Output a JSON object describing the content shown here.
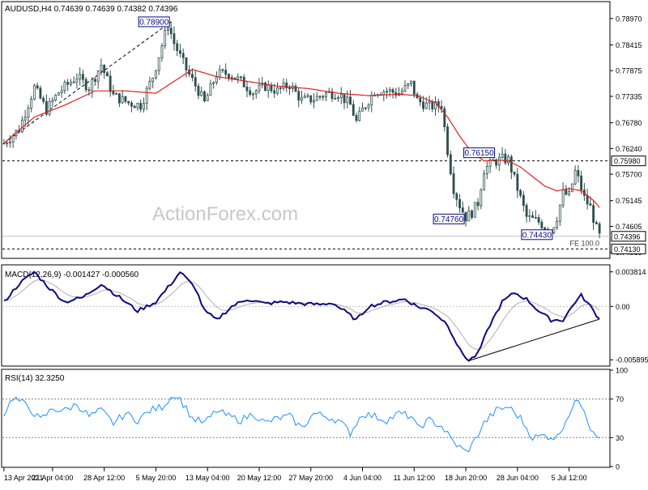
{
  "header": {
    "symbol_line": "AUDUSD,H4  0.74639 0.74639 0.74382 0.74396"
  },
  "watermark": "ActionForex.com",
  "colors": {
    "candles": "#2f4f4f",
    "ma": "#e02020",
    "macd_main": "#0b0b80",
    "macd_signal": "#b0b0b0",
    "rsi": "#1e90ff",
    "frame": "#000000",
    "grid_dash": "#808080",
    "label_box": "#0b0b80"
  },
  "chart_data": [
    {
      "type": "candlestick",
      "name": "price",
      "title": "AUDUSD,H4  0.74639 0.74639 0.74382 0.74396",
      "ylim": [
        0.7395,
        0.7929
      ],
      "y_ticks": [
        "0.78970",
        "0.78415",
        "0.77875",
        "0.77335",
        "0.76780",
        "0.76240",
        "0.75700",
        "0.75145",
        "0.74605",
        "0.74060"
      ],
      "y_tick_values": [
        0.7897,
        0.78415,
        0.77875,
        0.77335,
        0.7678,
        0.7624,
        0.757,
        0.75145,
        0.74605,
        0.7406
      ],
      "x_ticks": [
        "13 Apr 2021",
        "21 Apr 04:00",
        "28 Apr 12:00",
        "5 May 20:00",
        "13 May 04:00",
        "20 May 12:00",
        "27 May 20:00",
        "4 Jun 04:00",
        "11 Jun 12:00",
        "18 Jun 20:00",
        "28 Jun 04:00",
        "5 Jul 12:00"
      ],
      "x_tick_index": [
        0,
        16,
        33,
        50,
        67,
        84,
        101,
        118,
        135,
        152,
        169,
        186
      ],
      "bar_count": 197,
      "close_anchors": [
        [
          0,
          0.7635
        ],
        [
          5,
          0.7665
        ],
        [
          10,
          0.7752
        ],
        [
          14,
          0.7705
        ],
        [
          18,
          0.7742
        ],
        [
          24,
          0.7775
        ],
        [
          28,
          0.7752
        ],
        [
          32,
          0.78
        ],
        [
          36,
          0.7735
        ],
        [
          41,
          0.772
        ],
        [
          45,
          0.7715
        ],
        [
          49,
          0.7775
        ],
        [
          54,
          0.7885
        ],
        [
          56,
          0.7845
        ],
        [
          60,
          0.779
        ],
        [
          64,
          0.7745
        ],
        [
          66,
          0.772
        ],
        [
          70,
          0.778
        ],
        [
          74,
          0.7782
        ],
        [
          78,
          0.7765
        ],
        [
          82,
          0.7742
        ],
        [
          86,
          0.7755
        ],
        [
          90,
          0.7745
        ],
        [
          94,
          0.7758
        ],
        [
          98,
          0.7725
        ],
        [
          102,
          0.7728
        ],
        [
          106,
          0.774
        ],
        [
          110,
          0.774
        ],
        [
          114,
          0.7715
        ],
        [
          116,
          0.768
        ],
        [
          118,
          0.7705
        ],
        [
          122,
          0.7745
        ],
        [
          126,
          0.7745
        ],
        [
          130,
          0.774
        ],
        [
          134,
          0.776
        ],
        [
          136,
          0.7725
        ],
        [
          140,
          0.7712
        ],
        [
          144,
          0.7715
        ],
        [
          146,
          0.762
        ],
        [
          148,
          0.754
        ],
        [
          150,
          0.7505
        ],
        [
          152,
          0.748
        ],
        [
          154,
          0.749
        ],
        [
          156,
          0.751
        ],
        [
          158,
          0.758
        ],
        [
          161,
          0.7595
        ],
        [
          164,
          0.7602
        ],
        [
          166,
          0.76
        ],
        [
          168,
          0.756
        ],
        [
          172,
          0.748
        ],
        [
          176,
          0.747
        ],
        [
          180,
          0.745
        ],
        [
          182,
          0.748
        ],
        [
          184,
          0.753
        ],
        [
          186,
          0.7525
        ],
        [
          188,
          0.7575
        ],
        [
          189,
          0.756
        ],
        [
          191,
          0.752
        ],
        [
          193,
          0.75
        ],
        [
          195,
          0.7455
        ],
        [
          196,
          0.744
        ]
      ],
      "ma_anchors": [
        [
          0,
          0.7635
        ],
        [
          10,
          0.769
        ],
        [
          20,
          0.7715
        ],
        [
          30,
          0.7745
        ],
        [
          40,
          0.7745
        ],
        [
          50,
          0.774
        ],
        [
          56,
          0.7765
        ],
        [
          62,
          0.779
        ],
        [
          70,
          0.7775
        ],
        [
          80,
          0.7765
        ],
        [
          90,
          0.7755
        ],
        [
          100,
          0.775
        ],
        [
          110,
          0.774
        ],
        [
          120,
          0.7735
        ],
        [
          130,
          0.7738
        ],
        [
          136,
          0.7735
        ],
        [
          142,
          0.772
        ],
        [
          146,
          0.769
        ],
        [
          150,
          0.765
        ],
        [
          154,
          0.7615
        ],
        [
          158,
          0.7598
        ],
        [
          162,
          0.76
        ],
        [
          166,
          0.7598
        ],
        [
          170,
          0.7585
        ],
        [
          174,
          0.7565
        ],
        [
          178,
          0.7545
        ],
        [
          182,
          0.7535
        ],
        [
          186,
          0.754
        ],
        [
          190,
          0.7535
        ],
        [
          194,
          0.7515
        ],
        [
          196,
          0.75
        ]
      ],
      "labels": [
        {
          "text": "0.78900",
          "value": 0.789,
          "bar": 55
        },
        {
          "text": "0.76150",
          "value": 0.7615,
          "bar": 162
        },
        {
          "text": "0.74760",
          "value": 0.7476,
          "bar": 152
        },
        {
          "text": "0.74430",
          "value": 0.7443,
          "bar": 181
        }
      ],
      "hlines": [
        {
          "value": 0.7598,
          "label": "0.75980"
        },
        {
          "value": 0.7413,
          "label": "0.74130",
          "note": "FE 100.0"
        }
      ],
      "current_price": {
        "value": 0.74396,
        "label": "0.74396"
      },
      "trendline_from_to": [
        [
          0,
          0.7635
        ],
        [
          55,
          0.789
        ]
      ]
    },
    {
      "type": "line",
      "name": "macd",
      "title": "MACD(12,26,9) -0.001427 -0.000560",
      "ylim": [
        -0.0065,
        0.0045
      ],
      "y_ticks": [
        "0.003814",
        "0.00",
        "-0.005895"
      ],
      "y_tick_values": [
        0.003814,
        0.0,
        -0.005895
      ],
      "main_anchors": [
        [
          0,
          0.0005
        ],
        [
          5,
          0.0025
        ],
        [
          10,
          0.0038
        ],
        [
          15,
          0.002
        ],
        [
          20,
          0.0005
        ],
        [
          26,
          0.001
        ],
        [
          32,
          0.0025
        ],
        [
          38,
          0.001
        ],
        [
          44,
          -0.0005
        ],
        [
          50,
          0.0005
        ],
        [
          55,
          0.0025
        ],
        [
          58,
          0.0038
        ],
        [
          63,
          0.002
        ],
        [
          66,
          -0.0005
        ],
        [
          70,
          -0.0015
        ],
        [
          75,
          0.0
        ],
        [
          80,
          0.0008
        ],
        [
          86,
          0.0003
        ],
        [
          92,
          0.0005
        ],
        [
          98,
          0.0003
        ],
        [
          104,
          0.0002
        ],
        [
          108,
          0.0004
        ],
        [
          112,
          -0.0005
        ],
        [
          116,
          -0.0015
        ],
        [
          120,
          0.0
        ],
        [
          126,
          0.0005
        ],
        [
          132,
          0.0008
        ],
        [
          136,
          0.0
        ],
        [
          141,
          -0.0005
        ],
        [
          146,
          -0.002
        ],
        [
          150,
          -0.0048
        ],
        [
          153,
          -0.006
        ],
        [
          156,
          -0.0052
        ],
        [
          160,
          -0.002
        ],
        [
          164,
          0.0005
        ],
        [
          168,
          0.0015
        ],
        [
          172,
          0.0008
        ],
        [
          176,
          -0.0005
        ],
        [
          180,
          -0.0015
        ],
        [
          184,
          -0.0015
        ],
        [
          188,
          0.0005
        ],
        [
          190,
          0.0012
        ],
        [
          193,
          0.0
        ],
        [
          196,
          -0.0014
        ]
      ],
      "trendline_from_to": [
        [
          153,
          -0.006
        ],
        [
          196,
          -0.0014
        ]
      ]
    },
    {
      "type": "line",
      "name": "rsi",
      "title": "RSI(14) 32.3250",
      "ylim": [
        0,
        100
      ],
      "y_ticks": [
        "100",
        "70",
        "30",
        "0"
      ],
      "y_tick_values": [
        100,
        70,
        30,
        0
      ],
      "levels": [
        70,
        30
      ],
      "anchors": [
        [
          0,
          55
        ],
        [
          3,
          72
        ],
        [
          8,
          62
        ],
        [
          12,
          48
        ],
        [
          16,
          60
        ],
        [
          20,
          58
        ],
        [
          24,
          65
        ],
        [
          28,
          52
        ],
        [
          32,
          58
        ],
        [
          36,
          45
        ],
        [
          40,
          55
        ],
        [
          44,
          48
        ],
        [
          48,
          58
        ],
        [
          52,
          62
        ],
        [
          56,
          75
        ],
        [
          58,
          70
        ],
        [
          62,
          50
        ],
        [
          66,
          45
        ],
        [
          70,
          58
        ],
        [
          74,
          52
        ],
        [
          78,
          48
        ],
        [
          82,
          55
        ],
        [
          86,
          45
        ],
        [
          90,
          50
        ],
        [
          94,
          52
        ],
        [
          98,
          40
        ],
        [
          102,
          55
        ],
        [
          106,
          52
        ],
        [
          110,
          48
        ],
        [
          114,
          35
        ],
        [
          118,
          55
        ],
        [
          122,
          52
        ],
        [
          126,
          48
        ],
        [
          130,
          55
        ],
        [
          134,
          52
        ],
        [
          136,
          40
        ],
        [
          140,
          48
        ],
        [
          144,
          42
        ],
        [
          148,
          25
        ],
        [
          152,
          15
        ],
        [
          154,
          22
        ],
        [
          158,
          45
        ],
        [
          162,
          58
        ],
        [
          166,
          62
        ],
        [
          170,
          50
        ],
        [
          174,
          30
        ],
        [
          178,
          32
        ],
        [
          182,
          30
        ],
        [
          186,
          55
        ],
        [
          189,
          70
        ],
        [
          191,
          60
        ],
        [
          193,
          40
        ],
        [
          196,
          32
        ]
      ]
    }
  ]
}
